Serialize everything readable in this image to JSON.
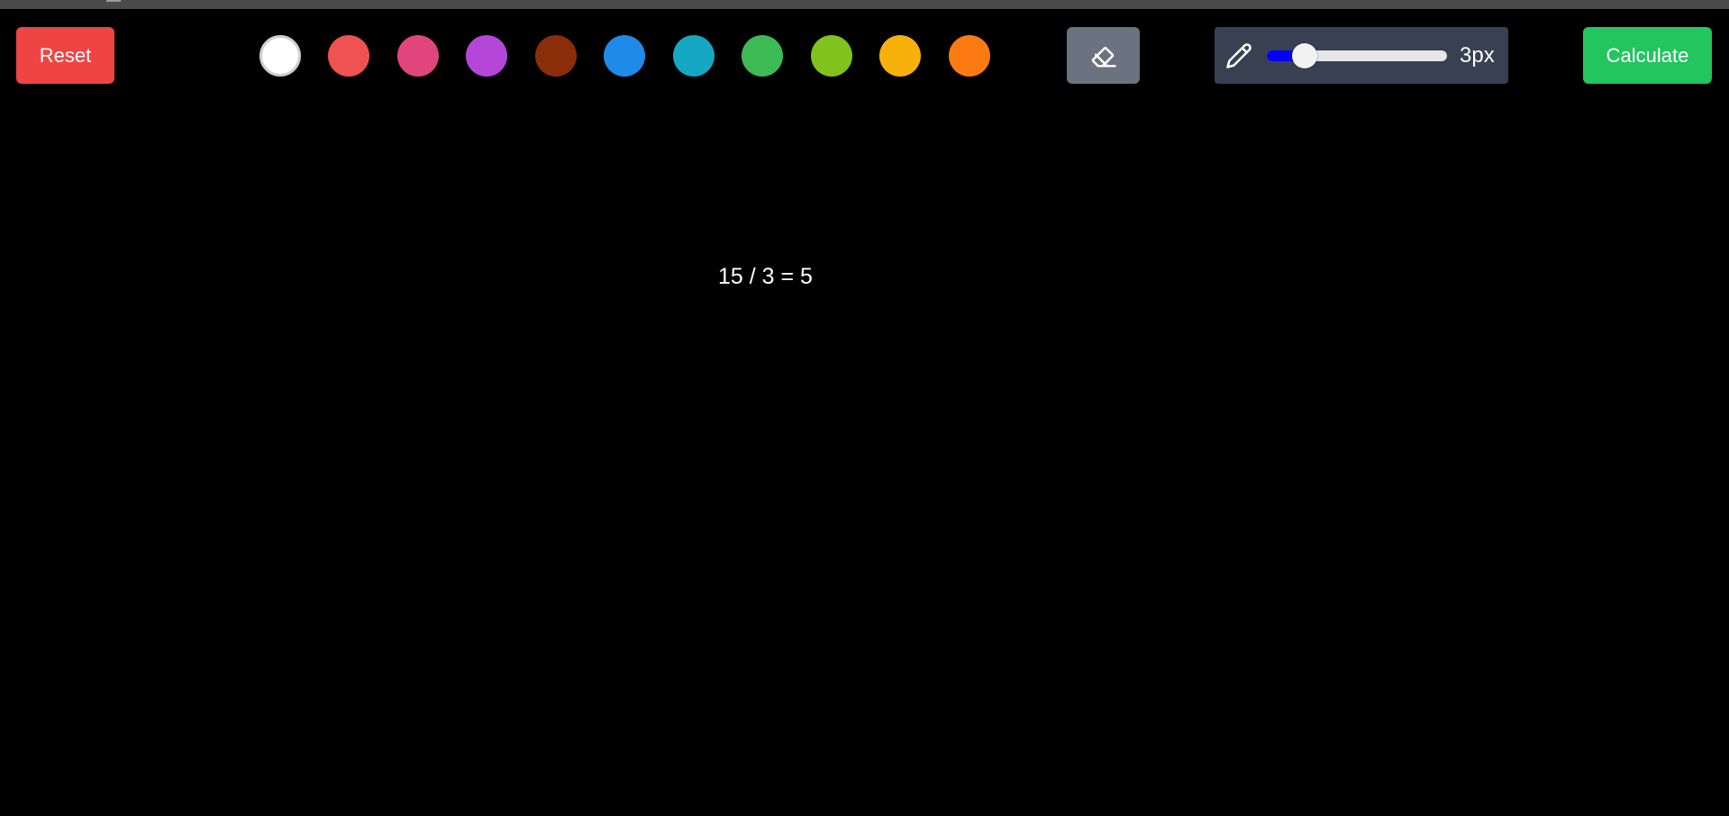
{
  "toolbar": {
    "reset_label": "Reset",
    "calculate_label": "Calculate",
    "colors": {
      "reset_bg": "#ef4444",
      "calculate_bg": "#22c55e",
      "eraser_bg": "#6b7280",
      "panel_bg": "#374151",
      "slider_fill": "#0000ff"
    },
    "swatches": [
      {
        "name": "black",
        "color": "#000000"
      },
      {
        "name": "white",
        "color": "#ffffff",
        "selected": true
      },
      {
        "name": "red",
        "color": "#f05252"
      },
      {
        "name": "pink",
        "color": "#e0467c"
      },
      {
        "name": "purple",
        "color": "#b547d8"
      },
      {
        "name": "brown",
        "color": "#8a2e0a"
      },
      {
        "name": "blue",
        "color": "#1f8ae8"
      },
      {
        "name": "cyan",
        "color": "#14a8c2"
      },
      {
        "name": "green",
        "color": "#3cba54"
      },
      {
        "name": "lime",
        "color": "#7fc31c"
      },
      {
        "name": "amber",
        "color": "#f7b10a"
      },
      {
        "name": "orange",
        "color": "#fb7b12"
      }
    ],
    "eraser_icon": "eraser-icon",
    "brush": {
      "icon": "pencil-icon",
      "size_label": "3px",
      "min": 1,
      "max": 30,
      "value": 3
    }
  },
  "canvas": {
    "result_text": "15 / 3 = 5"
  }
}
